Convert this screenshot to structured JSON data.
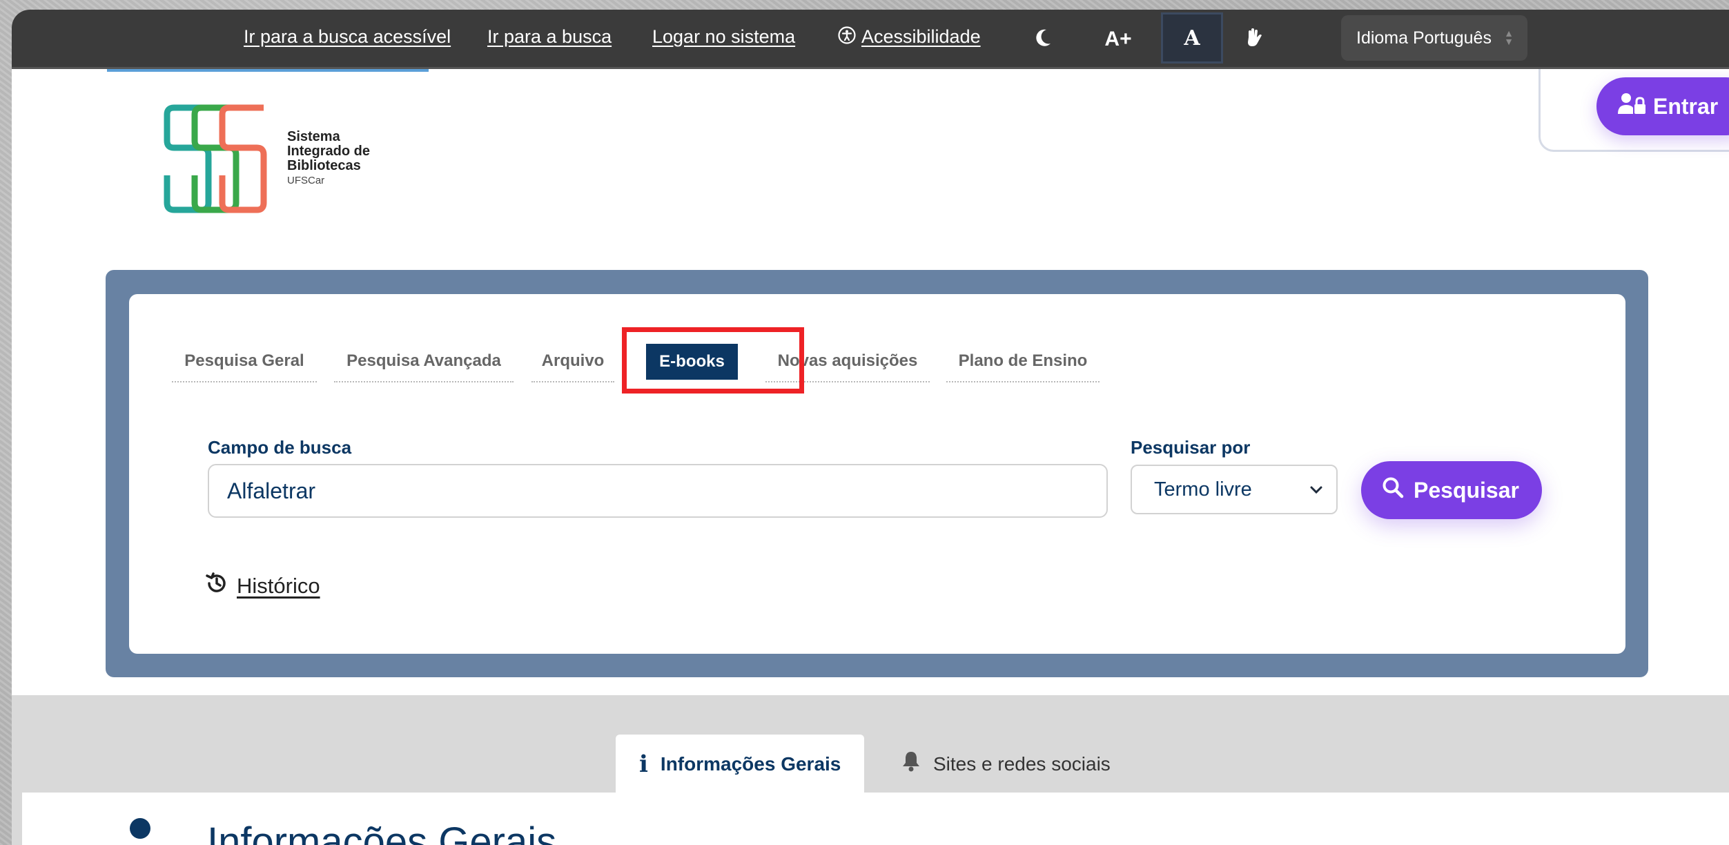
{
  "topbar": {
    "links": [
      "Ir para a busca acessível",
      "Ir para a busca",
      "Logar no sistema"
    ],
    "accessibility_label": "Acessibilidade",
    "font_increase_label": "A+",
    "font_normal_label": "A",
    "language": {
      "selected": "Idioma Português"
    }
  },
  "logo": {
    "line1": "Sistema",
    "line2": "Integrado de",
    "line3": "Bibliotecas",
    "line4": "UFSCar",
    "colors": [
      "#26a69a",
      "#3aa84a",
      "#ee6f57"
    ]
  },
  "header": {
    "login_label": "Entrar"
  },
  "search": {
    "tabs": [
      {
        "label": "Pesquisa Geral"
      },
      {
        "label": "Pesquisa Avançada"
      },
      {
        "label": "Arquivo"
      },
      {
        "label": "E-books",
        "active": true
      },
      {
        "label": "Novas aquisições"
      },
      {
        "label": "Plano de Ensino"
      }
    ],
    "field_label": "Campo de busca",
    "field_value": "Alfaletrar",
    "search_by_label": "Pesquisar por",
    "search_by_value": "Termo livre",
    "submit_label": "Pesquisar",
    "history_label": "Histórico"
  },
  "info": {
    "tabs": [
      {
        "label": "Informações Gerais",
        "icon": "info-icon",
        "active": true
      },
      {
        "label": "Sites e redes sociais",
        "icon": "bell-icon"
      }
    ],
    "section_title": "Informações Gerais"
  },
  "colors": {
    "primary_purple": "#7b3fe4",
    "navy": "#0c3763",
    "panel_blue": "#6882a3",
    "highlight_red": "#ee2226",
    "topbar": "#3b3b3b"
  }
}
